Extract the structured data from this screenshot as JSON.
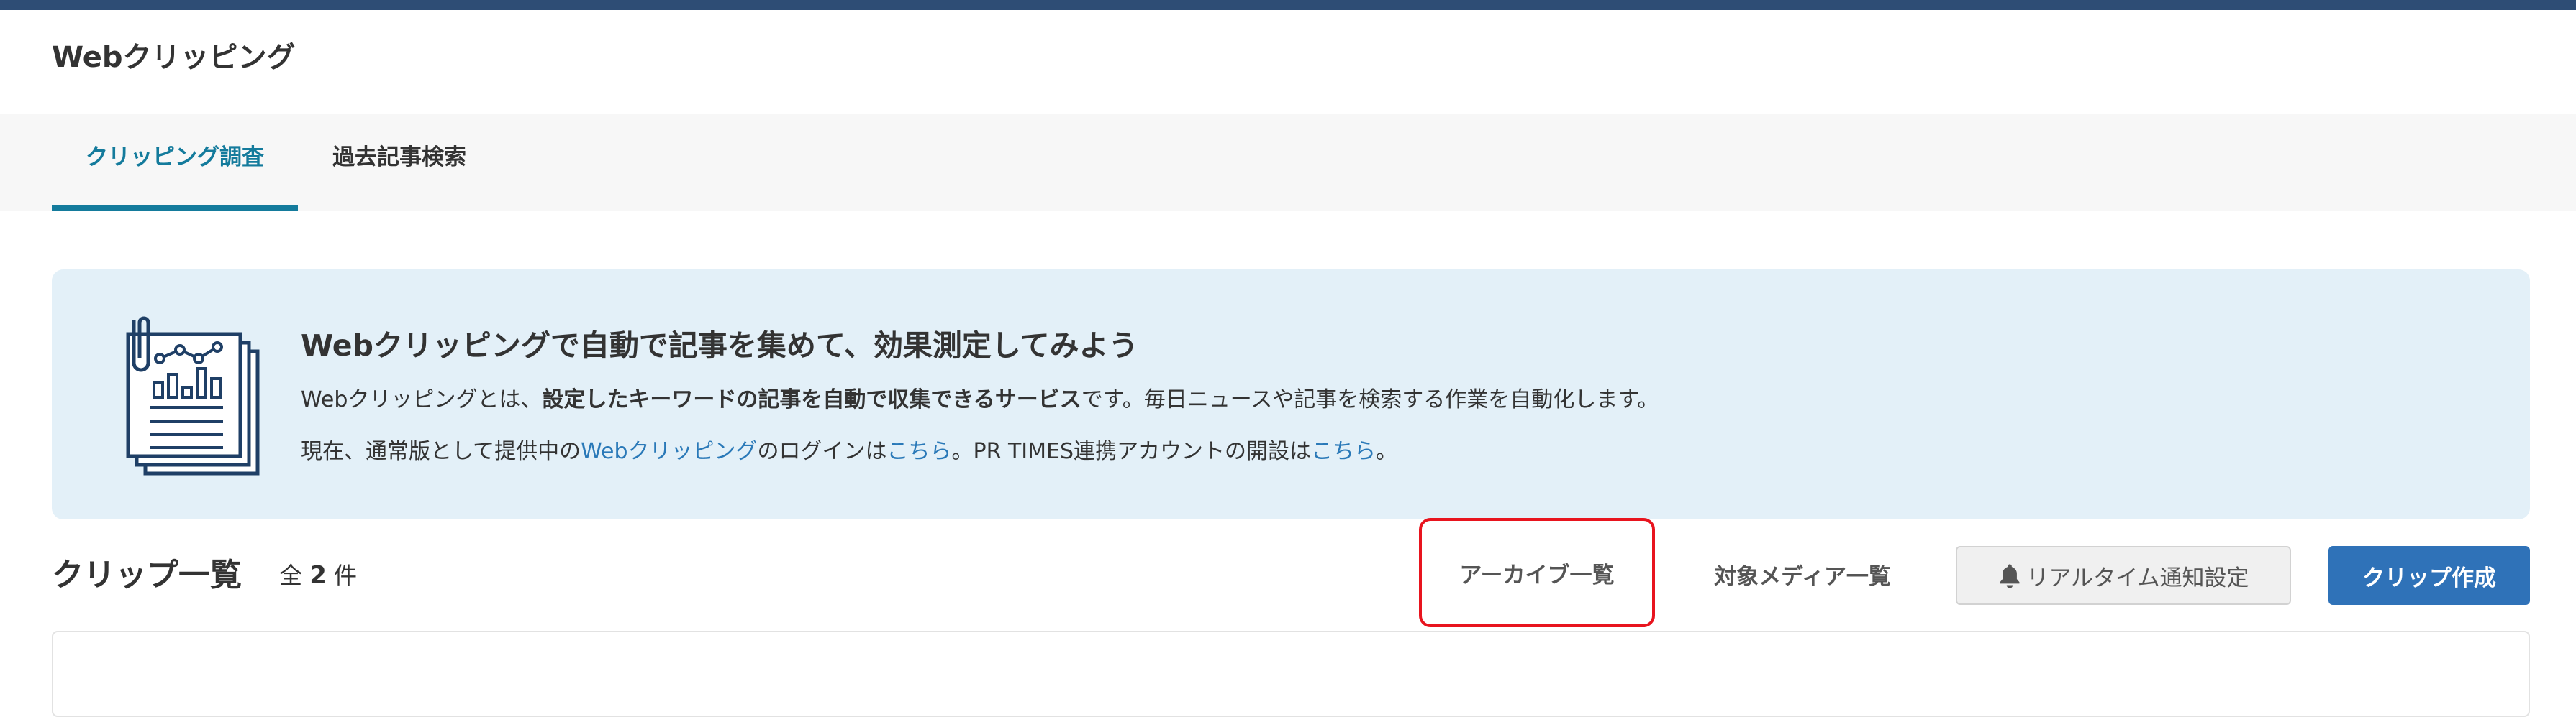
{
  "header": {
    "title": "Webクリッピング"
  },
  "tabs": [
    {
      "label": "クリッピング調査",
      "active": true
    },
    {
      "label": "過去記事検索",
      "active": false
    }
  ],
  "banner": {
    "title": "Webクリッピングで自動で記事を集めて、効果測定してみよう",
    "line1_prefix": "Webクリッピングとは、",
    "line1_bold": "設定したキーワードの記事を自動で収集できるサービス",
    "line1_suffix": "です。毎日ニュースや記事を検索する作業を自動化します。",
    "line2_a": "現在、通常版として提供中の",
    "line2_link1": "Webクリッピング",
    "line2_b": "のログインは",
    "line2_link2": "こちら",
    "line2_c": "。PR TIMES連携アカウントの開設は",
    "line2_link3": "こちら",
    "line2_d": "。",
    "icon": "document-report-icon"
  },
  "clips": {
    "title": "クリップ一覧",
    "count_prefix": "全",
    "count": "2",
    "count_suffix": "件"
  },
  "actions": {
    "archive": "アーカイブ一覧",
    "media": "対象メディア一覧",
    "notify": "リアルタイム通知設定",
    "create": "クリップ作成"
  },
  "colors": {
    "top_bar": "#2e4d75",
    "accent": "#147b9c",
    "link": "#2a79b8",
    "primary_button": "#2f72b8",
    "highlight_border": "#e8141e",
    "banner_bg": "#e3f0f8"
  }
}
